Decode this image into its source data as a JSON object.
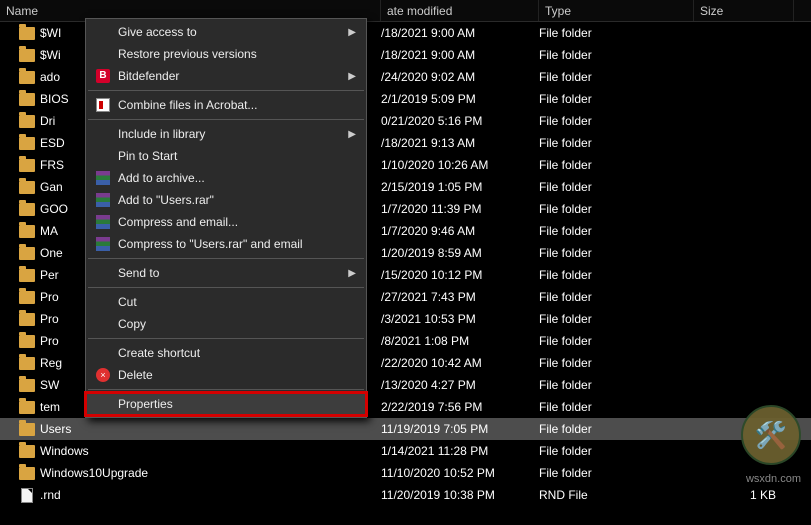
{
  "columns": {
    "name": "Name",
    "date": "ate modified",
    "type": "Type",
    "size": "Size"
  },
  "rows": [
    {
      "icon": "folder",
      "name": "$WI",
      "date": "/18/2021 9:00 AM",
      "type": "File folder",
      "size": "",
      "trunc": true
    },
    {
      "icon": "folder",
      "name": "$Wi",
      "date": "/18/2021 9:00 AM",
      "type": "File folder",
      "size": "",
      "trunc": true
    },
    {
      "icon": "folder",
      "name": "ado",
      "date": "/24/2020 9:02 AM",
      "type": "File folder",
      "size": "",
      "trunc": true
    },
    {
      "icon": "folder",
      "name": "BIOS",
      "date": "2/1/2019 5:09 PM",
      "type": "File folder",
      "size": "",
      "trunc": false
    },
    {
      "icon": "folder",
      "name": "Dri",
      "date": "0/21/2020 5:16 PM",
      "type": "File folder",
      "size": "",
      "trunc": true
    },
    {
      "icon": "folder",
      "name": "ESD",
      "date": "/18/2021 9:13 AM",
      "type": "File folder",
      "size": "",
      "trunc": true
    },
    {
      "icon": "folder",
      "name": "FRS",
      "date": "1/10/2020 10:26 AM",
      "type": "File folder",
      "size": "",
      "trunc": true
    },
    {
      "icon": "folder",
      "name": "Gan",
      "date": "2/15/2019 1:05 PM",
      "type": "File folder",
      "size": "",
      "trunc": true
    },
    {
      "icon": "folder",
      "name": "GOO",
      "date": "1/7/2020 11:39 PM",
      "type": "File folder",
      "size": "",
      "trunc": true
    },
    {
      "icon": "folder",
      "name": "MA",
      "date": "1/7/2020 9:46 AM",
      "type": "File folder",
      "size": "",
      "trunc": true
    },
    {
      "icon": "folder",
      "name": "One",
      "date": "1/20/2019 8:59 AM",
      "type": "File folder",
      "size": "",
      "trunc": true
    },
    {
      "icon": "folder",
      "name": "Per",
      "date": "/15/2020 10:12 PM",
      "type": "File folder",
      "size": "",
      "trunc": true
    },
    {
      "icon": "folder",
      "name": "Pro",
      "date": "/27/2021 7:43 PM",
      "type": "File folder",
      "size": "",
      "trunc": true
    },
    {
      "icon": "folder",
      "name": "Pro",
      "date": "/3/2021 10:53 PM",
      "type": "File folder",
      "size": "",
      "trunc": true
    },
    {
      "icon": "folder",
      "name": "Pro",
      "date": "/8/2021 1:08 PM",
      "type": "File folder",
      "size": "",
      "trunc": true
    },
    {
      "icon": "folder",
      "name": "Reg",
      "date": "/22/2020 10:42 AM",
      "type": "File folder",
      "size": "",
      "trunc": true
    },
    {
      "icon": "folder",
      "name": "SW",
      "date": "/13/2020 4:27 PM",
      "type": "File folder",
      "size": "",
      "trunc": true
    },
    {
      "icon": "folder",
      "name": "tem",
      "date": "2/22/2019 7:56 PM",
      "type": "File folder",
      "size": "",
      "trunc": true
    },
    {
      "icon": "folder",
      "name": "Users",
      "date": "11/19/2019 7:05 PM",
      "type": "File folder",
      "size": "",
      "selected": true
    },
    {
      "icon": "folder",
      "name": "Windows",
      "date": "1/14/2021 11:28 PM",
      "type": "File folder",
      "size": ""
    },
    {
      "icon": "folder",
      "name": "Windows10Upgrade",
      "date": "11/10/2020 10:52 PM",
      "type": "File folder",
      "size": ""
    },
    {
      "icon": "file",
      "name": ".rnd",
      "date": "11/20/2019 10:38 PM",
      "type": "RND File",
      "size": "1 KB"
    }
  ],
  "menu": [
    {
      "kind": "item",
      "label": "Give access to",
      "arrow": true,
      "icon": ""
    },
    {
      "kind": "item",
      "label": "Restore previous versions",
      "icon": ""
    },
    {
      "kind": "item",
      "label": "Bitdefender",
      "arrow": true,
      "icon": "bd",
      "icon_text": "B"
    },
    {
      "kind": "sep"
    },
    {
      "kind": "item",
      "label": "Combine files in Acrobat...",
      "icon": "acro"
    },
    {
      "kind": "sep"
    },
    {
      "kind": "item",
      "label": "Include in library",
      "arrow": true,
      "icon": ""
    },
    {
      "kind": "item",
      "label": "Pin to Start",
      "icon": ""
    },
    {
      "kind": "item",
      "label": "Add to archive...",
      "icon": "rar"
    },
    {
      "kind": "item",
      "label": "Add to \"Users.rar\"",
      "icon": "rar"
    },
    {
      "kind": "item",
      "label": "Compress and email...",
      "icon": "rar"
    },
    {
      "kind": "item",
      "label": "Compress to \"Users.rar\" and email",
      "icon": "rar"
    },
    {
      "kind": "sep"
    },
    {
      "kind": "item",
      "label": "Send to",
      "arrow": true,
      "icon": ""
    },
    {
      "kind": "sep"
    },
    {
      "kind": "item",
      "label": "Cut",
      "icon": ""
    },
    {
      "kind": "item",
      "label": "Copy",
      "icon": ""
    },
    {
      "kind": "sep"
    },
    {
      "kind": "item",
      "label": "Create shortcut",
      "icon": ""
    },
    {
      "kind": "item",
      "label": "Delete",
      "icon": "del",
      "icon_text": "×"
    },
    {
      "kind": "sep"
    },
    {
      "kind": "item",
      "label": "Properties",
      "icon": "",
      "highlight": true
    }
  ],
  "watermark": "wsxdn.com"
}
